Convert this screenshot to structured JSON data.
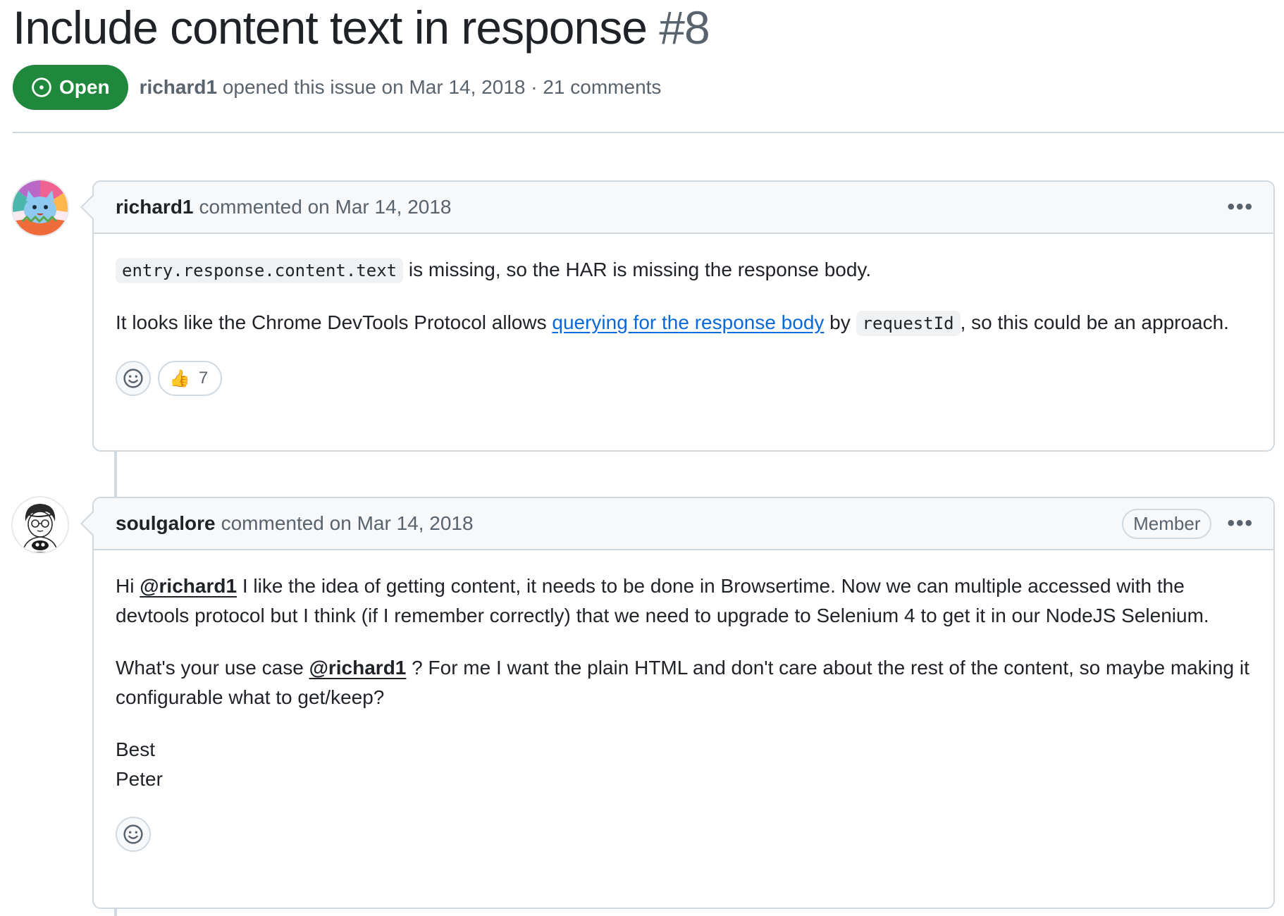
{
  "issue": {
    "title": "Include content text in response",
    "number": "#8",
    "state": "Open",
    "author": "richard1",
    "meta": "opened this issue on Mar 14, 2018 · 21 comments"
  },
  "comments": [
    {
      "author": "richard1",
      "meta": "commented on Mar 14, 2018",
      "kebab": "•••",
      "p1_code": "entry.response.content.text",
      "p1_text": " is missing, so the HAR is missing the response body.",
      "p2_pre": "It looks like the Chrome DevTools Protocol allows ",
      "p2_link": "querying for the response body",
      "p2_mid": " by ",
      "p2_code": "requestId",
      "p2_post": ", so this could be an approach.",
      "reaction_emoji": "👍",
      "reaction_count": "7"
    },
    {
      "author": "soulgalore",
      "meta": "commented on Mar 14, 2018",
      "badge": "Member",
      "kebab": "•••",
      "p1_pre": "Hi ",
      "p1_mention": "@richard1",
      "p1_post": " I like the idea of getting content, it needs to be done in Browsertime. Now we can multiple accessed with the devtools protocol but I think (if I remember correctly) that we need to upgrade to Selenium 4 to get it in our NodeJS Selenium.",
      "p2_pre": "What's your use case ",
      "p2_mention": "@richard1",
      "p2_post": " ? For me I want the plain HTML and don't care about the rest of the content, so maybe making it configurable what to get/keep?",
      "p3_line1": "Best",
      "p3_line2": "Peter"
    }
  ],
  "colors": {
    "open_green": "#1f883d",
    "link_blue": "#0969da",
    "muted": "#59636e"
  },
  "icons": {
    "state": "issue-opened-icon",
    "add_reaction": "smiley-icon",
    "menu": "kebab-horizontal-icon"
  }
}
